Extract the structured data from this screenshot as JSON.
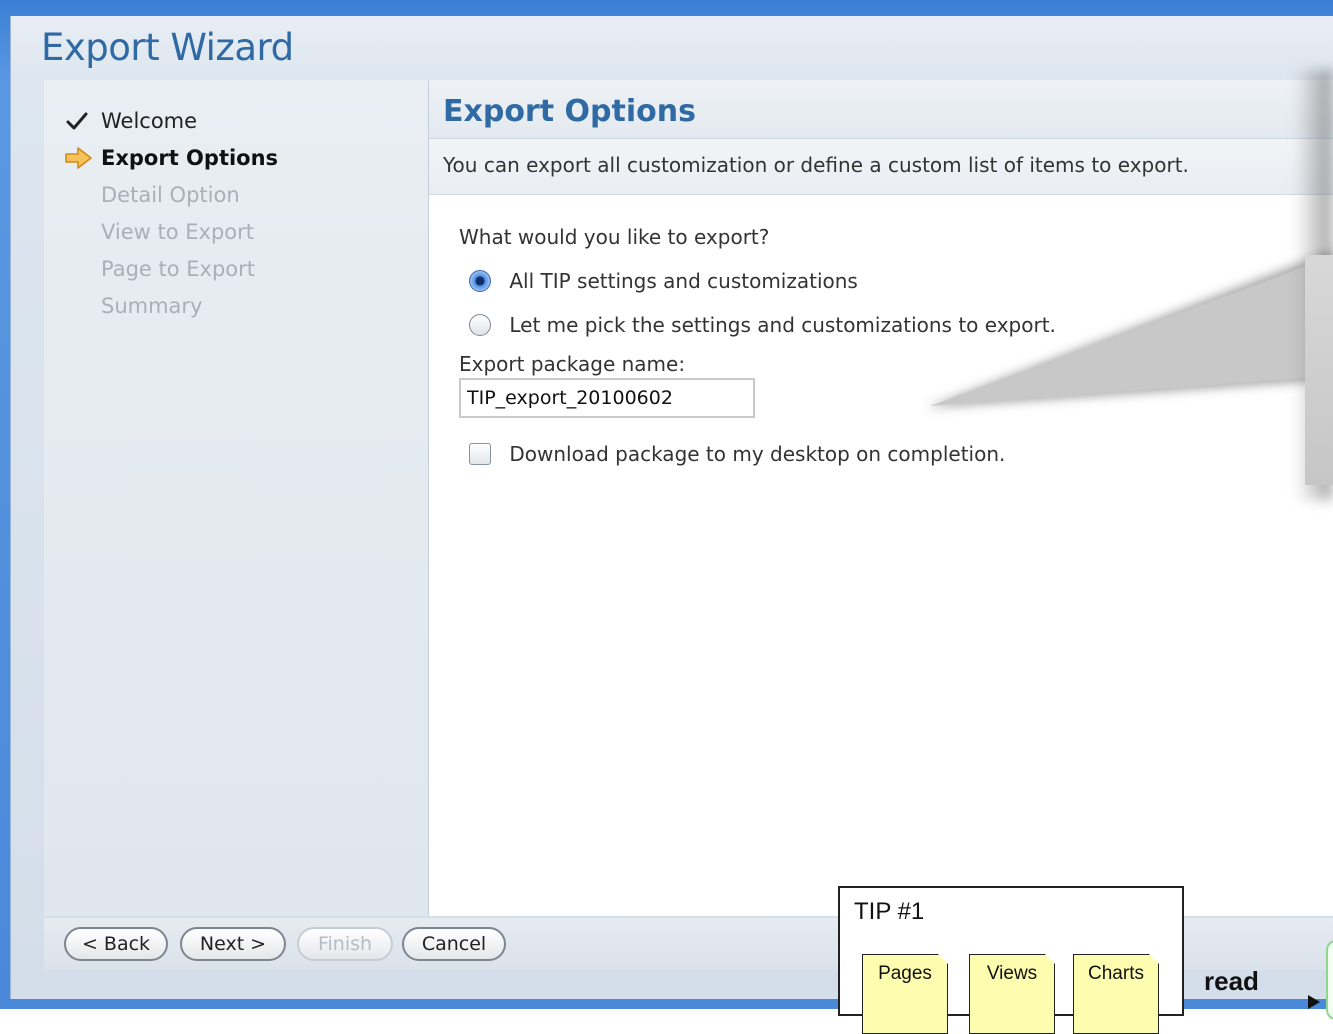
{
  "window": {
    "title": "Export Wizard"
  },
  "steps": [
    {
      "label": "Welcome",
      "state": "done",
      "icon": "checkmark-icon"
    },
    {
      "label": "Export Options",
      "state": "current",
      "icon": "arrow-right-icon"
    },
    {
      "label": "Detail Option",
      "state": "pending"
    },
    {
      "label": "View to Export",
      "state": "pending"
    },
    {
      "label": "Page to Export",
      "state": "pending"
    },
    {
      "label": "Summary",
      "state": "pending"
    }
  ],
  "page": {
    "title": "Export Options",
    "description": "You can export all customization or define a custom list of items to export.",
    "question": "What would you like to export?",
    "options": [
      {
        "label": "All TIP settings and customizations",
        "selected": true
      },
      {
        "label": "Let me pick the settings and customizations to export.",
        "selected": false
      }
    ],
    "package_name_label": "Export package name:",
    "package_name_value": "TIP_export_20100602",
    "download_label": "Download package to my desktop on completion.",
    "download_checked": false
  },
  "buttons": {
    "back": "< Back",
    "next": "Next >",
    "finish": "Finish",
    "cancel": "Cancel"
  },
  "tip": {
    "title": "TIP #1",
    "docs": [
      "Pages",
      "Views",
      "Charts"
    ],
    "side_label": "read"
  },
  "colors": {
    "accent": "#2f6aa5",
    "frame": "#4a88da",
    "current_arrow": "#f0a830",
    "doc_fill": "#fdfdb0"
  }
}
